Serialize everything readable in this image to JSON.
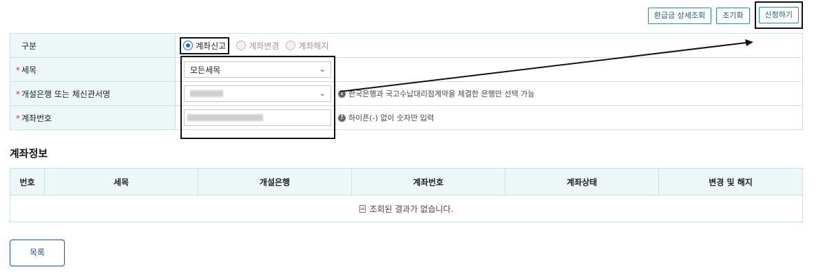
{
  "toolbar": {
    "refund_detail_label": "환급금 상세조회",
    "reset_label": "초기화",
    "apply_label": "신청하기"
  },
  "form": {
    "type_label": "구분",
    "radio_options": [
      "계좌신고",
      "계좌변경",
      "계좌해지"
    ],
    "selected_radio": "계좌신고",
    "tax_label": "세목",
    "tax_value": "모든세목",
    "bank_label": "개설은행 또는 체신관서명",
    "bank_hint": "한국은행과 국고수납대리점계약을 체결한 은행만 선택 가능",
    "account_label": "계좌번호",
    "account_hint": "하이픈(-) 없이 숫자만 입력",
    "required_mark": "*"
  },
  "section": {
    "title": "계좌정보"
  },
  "table": {
    "columns": [
      "번호",
      "세목",
      "개설은행",
      "계좌번호",
      "계좌상태",
      "변경 및 해지"
    ],
    "empty_message": "조회된 결과가 없습니다."
  },
  "footer": {
    "list_label": "목록"
  },
  "colors": {
    "accent": "#2a8a94",
    "header_bg": "#eef7f7",
    "border": "#c9e0e2",
    "required": "#d32f2f",
    "radio_on": "#1a66d8",
    "list_button": "#1a4fa0"
  }
}
